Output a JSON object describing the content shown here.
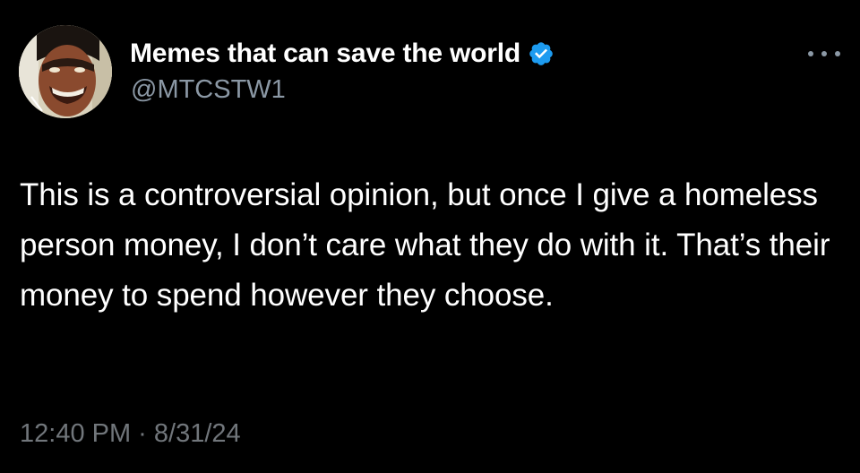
{
  "tweet": {
    "display_name": "Memes that can save the world",
    "verified": true,
    "handle": "@MTCSTW1",
    "text": "This is a controversial opinion, but once I give a homeless person money, I don’t care what they do with it. That’s their money to spend however they choose.",
    "timestamp": "12:40 PM · 8/31/24",
    "icons": {
      "verified": "verified-badge-icon",
      "more": "more-options-icon"
    },
    "colors": {
      "background": "#000000",
      "name": "#ffffff",
      "handle": "#8b98a5",
      "text": "#ffffff",
      "meta": "#71767b",
      "verified": "#1d9bf0"
    }
  }
}
